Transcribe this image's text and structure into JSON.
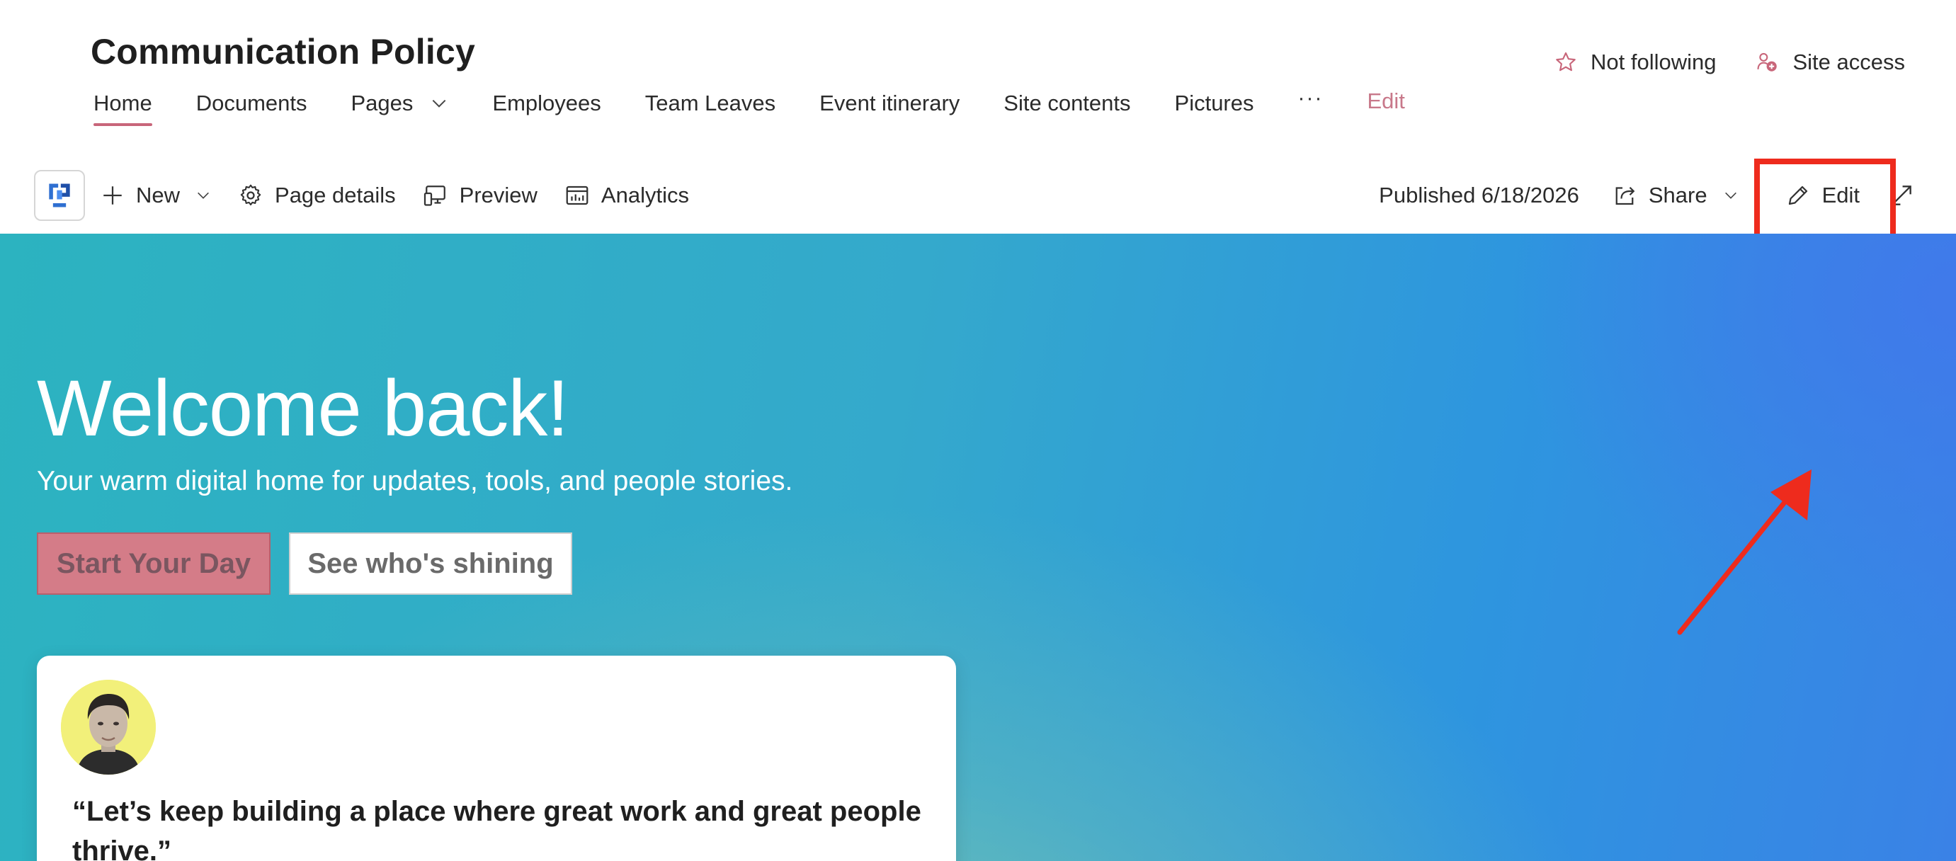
{
  "site": {
    "title": "Communication Policy",
    "nav": [
      {
        "label": "Home",
        "active": true
      },
      {
        "label": "Documents"
      },
      {
        "label": "Pages",
        "has_dropdown": true
      },
      {
        "label": "Employees"
      },
      {
        "label": "Team Leaves"
      },
      {
        "label": "Event itinerary"
      },
      {
        "label": "Site contents"
      },
      {
        "label": "Pictures"
      }
    ],
    "more_label": "···",
    "edit_label": "Edit",
    "actions": {
      "follow_label": "Not following",
      "site_access_label": "Site access"
    }
  },
  "command_bar": {
    "new_label": "New",
    "page_details_label": "Page details",
    "preview_label": "Preview",
    "analytics_label": "Analytics",
    "published_label": "Published 6/18/2026",
    "share_label": "Share",
    "edit_label": "Edit"
  },
  "hero": {
    "title": "Welcome back!",
    "subtitle": "Your warm digital home for updates, tools, and people stories.",
    "primary_button": "Start Your Day",
    "secondary_button": "See who's shining",
    "quote": "“Let’s keep building a place where great work and great people thrive.”"
  },
  "colors": {
    "accent_pink": "#c8667a",
    "annotation_red": "#ee2b1d",
    "hero_start": "#2cb3c0",
    "hero_end": "#3a82e6"
  },
  "icons": [
    "star-icon",
    "site-access-icon",
    "app-logo-icon",
    "plus-icon",
    "gear-icon",
    "preview-icon",
    "analytics-icon",
    "share-icon",
    "pencil-icon",
    "expand-icon",
    "chevron-down-icon"
  ]
}
